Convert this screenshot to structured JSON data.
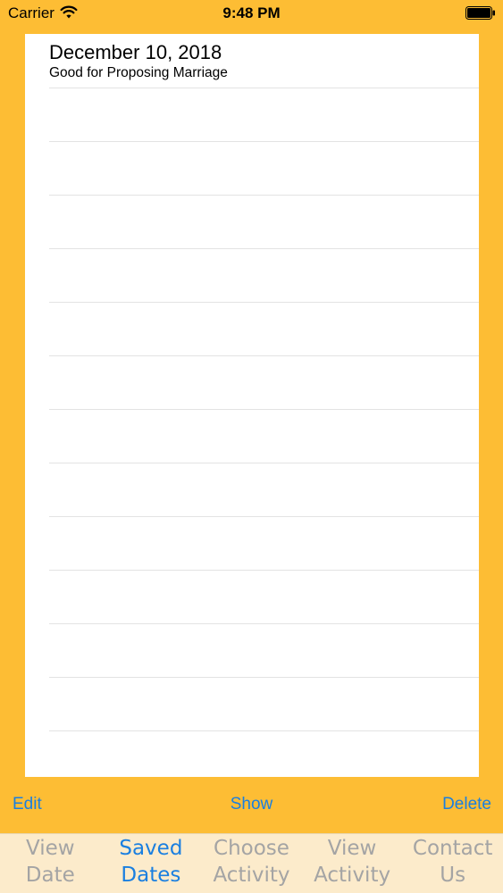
{
  "status_bar": {
    "carrier": "Carrier",
    "time": "9:48 PM"
  },
  "saved_dates": [
    {
      "date": "December 10, 2018",
      "activity": "Good for Proposing Marriage"
    }
  ],
  "actions": {
    "edit": "Edit",
    "show": "Show",
    "delete": "Delete"
  },
  "tabs": [
    {
      "line1": "View",
      "line2": "Date",
      "active": false
    },
    {
      "line1": "Saved",
      "line2": "Dates",
      "active": true
    },
    {
      "line1": "Choose",
      "line2": "Activity",
      "active": false
    },
    {
      "line1": "View",
      "line2": "Activity",
      "active": false
    },
    {
      "line1": "Contact",
      "line2": "Us",
      "active": false
    }
  ],
  "colors": {
    "background": "#FDBD34",
    "accent": "#1A7FE0",
    "tab_inactive": "#A4A4A4",
    "tabbar": "#FCEBCB"
  }
}
